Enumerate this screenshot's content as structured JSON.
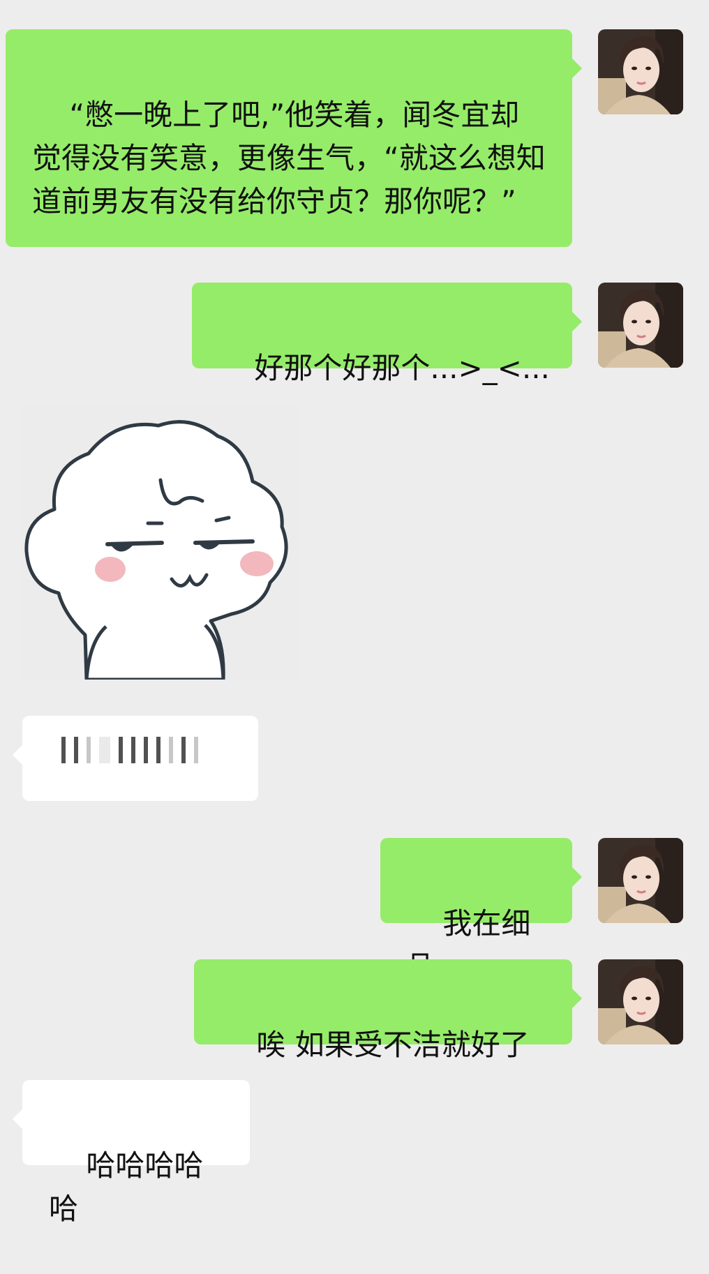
{
  "conversation": {
    "messages": [
      {
        "side": "mine",
        "type": "text",
        "text": "“憋一晚上了吧,”他笑着，闻冬宜却觉得没有笑意，更像生气，“就这么想知道前男友有没有给你守贞？那你呢？”"
      },
      {
        "side": "mine",
        "type": "text",
        "text": "好那个好那个...>_<..."
      },
      {
        "side": "theirs",
        "type": "sticker",
        "icon": "smug-cloud-face-sticker"
      },
      {
        "side": "theirs",
        "type": "voice",
        "icon": "voice-waveform-icon"
      },
      {
        "side": "mine",
        "type": "text",
        "text": "我在细品"
      },
      {
        "side": "mine",
        "type": "text",
        "text": "唉 如果受不洁就好了"
      },
      {
        "side": "theirs",
        "type": "text",
        "text": "哈哈哈哈哈"
      }
    ]
  },
  "colors": {
    "background": "#ededed",
    "mine_bubble": "#95ec69",
    "theirs_bubble": "#ffffff"
  }
}
